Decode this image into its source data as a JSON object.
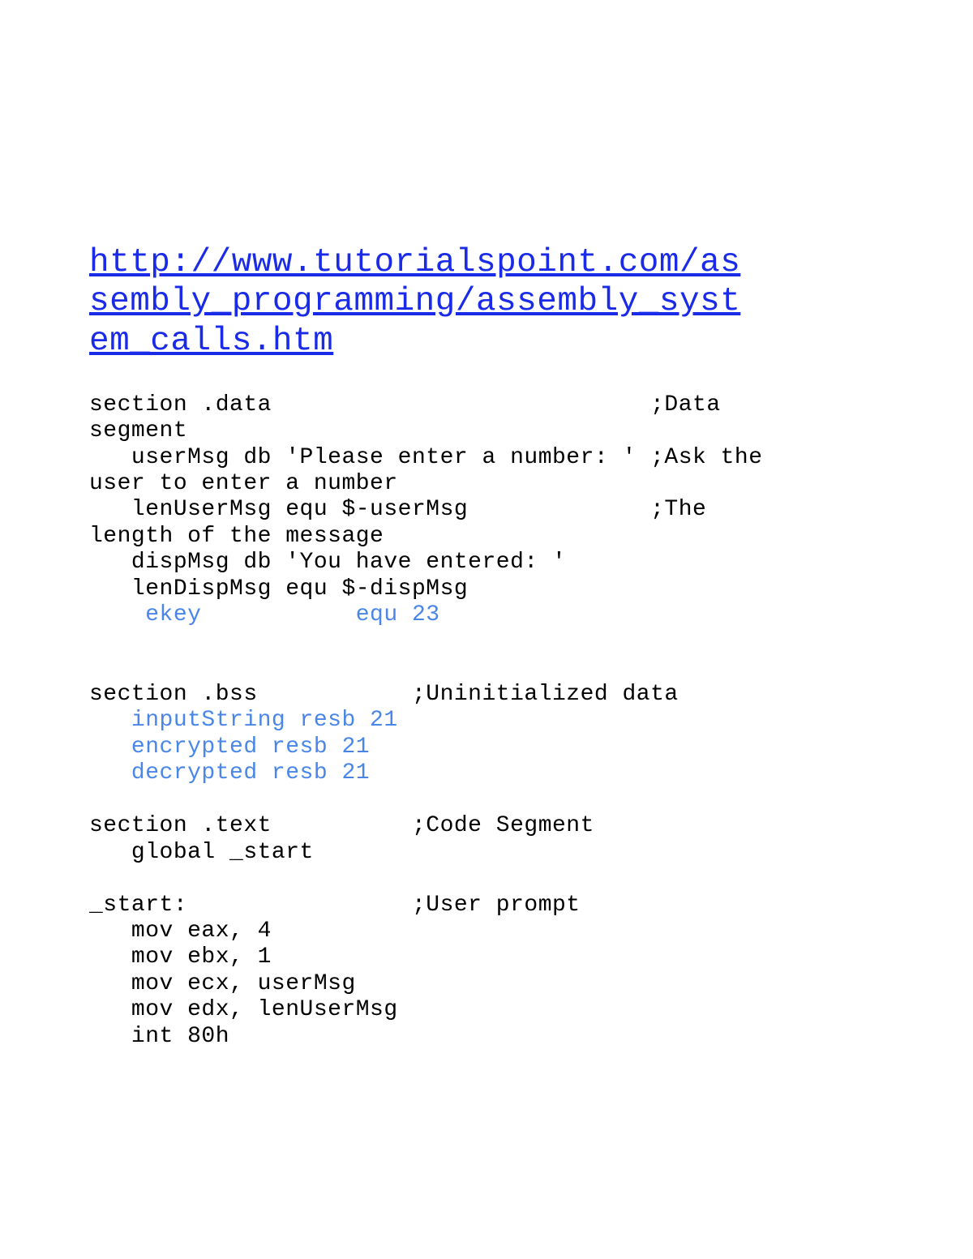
{
  "link": {
    "url": "http://www.tutorialspoint.com/assembly_programming/assembly_system_calls.htm",
    "display_line1": "http://www.tutorialspoint.com/as",
    "display_line2": "sembly_programming/assembly_syst",
    "display_line3": "em_calls.htm"
  },
  "code": {
    "l01": "section .data                           ;Data ",
    "l02": "segment",
    "l03": "   userMsg db 'Please enter a number: ' ;Ask the ",
    "l04": "user to enter a number",
    "l05": "   lenUserMsg equ $-userMsg             ;The ",
    "l06": "length of the message",
    "l07": "   dispMsg db 'You have entered: '",
    "l08": "   lenDispMsg equ $-dispMsg                 ",
    "l09": "    ekey           equ 23",
    "l10": " ",
    "l11": " ",
    "l12": "section .bss           ;Uninitialized data",
    "l13": "   inputString resb 21",
    "l14": "   encrypted resb 21",
    "l15": "   decrypted resb 21",
    "l16": " ",
    "l17": "section .text          ;Code Segment",
    "l18": "   global _start",
    "l19": " ",
    "l20": "_start:                ;User prompt",
    "l21": "   mov eax, 4",
    "l22": "   mov ebx, 1",
    "l23": "   mov ecx, userMsg",
    "l24": "   mov edx, lenUserMsg",
    "l25": "   int 80h"
  }
}
